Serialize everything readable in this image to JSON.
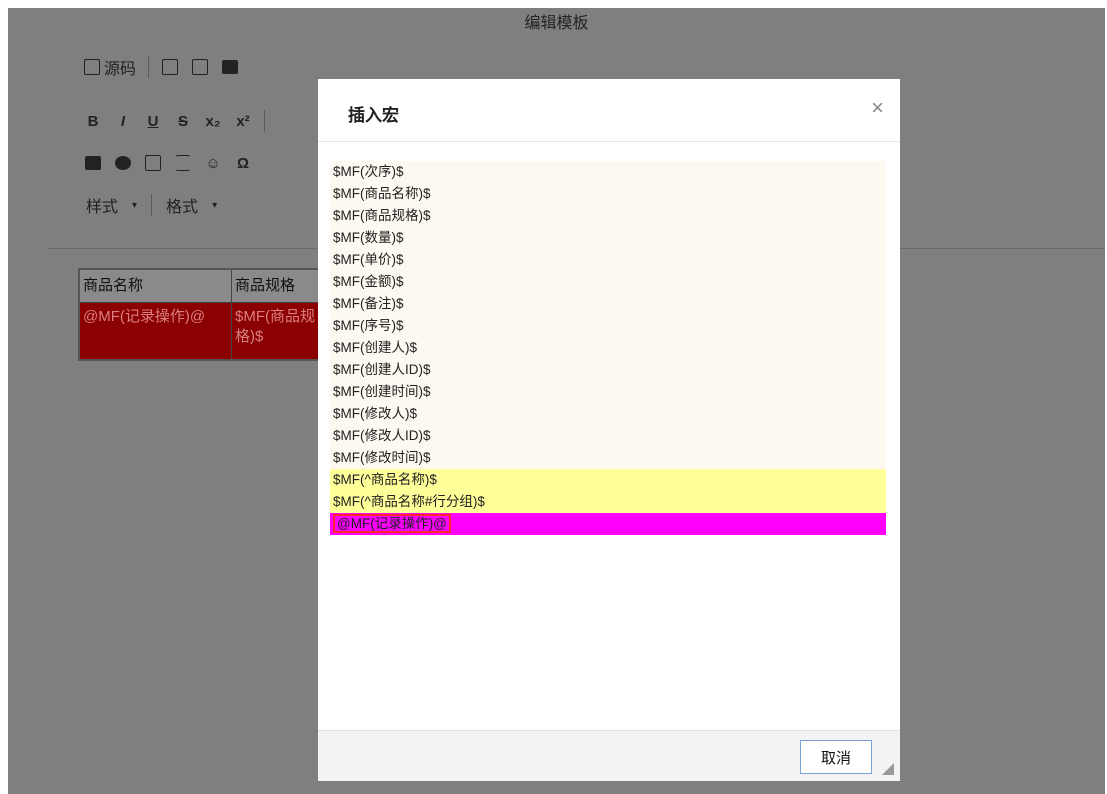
{
  "window": {
    "title": "编辑模板"
  },
  "toolbar": {
    "source_label": "源码",
    "style_label": "样式",
    "format_label": "格式",
    "bold": "B",
    "italic": "I",
    "underline": "U",
    "strike": "S",
    "subscript": "x₂",
    "superscript": "x²",
    "omega": "Ω",
    "smiley": "☺"
  },
  "table": {
    "headers": [
      "商品名称",
      "商品规格"
    ],
    "cells": [
      "@MF(记录操作)@",
      "$MF(商品规格)$"
    ]
  },
  "dialog": {
    "title": "插入宏",
    "close": "×",
    "cancel_label": "取消",
    "macros": [
      {
        "text": "$MF(次序)$",
        "highlight": "none"
      },
      {
        "text": "$MF(商品名称)$",
        "highlight": "none"
      },
      {
        "text": "$MF(商品规格)$",
        "highlight": "none"
      },
      {
        "text": "$MF(数量)$",
        "highlight": "none"
      },
      {
        "text": "$MF(单价)$",
        "highlight": "none"
      },
      {
        "text": "$MF(金额)$",
        "highlight": "none"
      },
      {
        "text": "$MF(备注)$",
        "highlight": "none"
      },
      {
        "text": "$MF(序号)$",
        "highlight": "none"
      },
      {
        "text": "$MF(创建人)$",
        "highlight": "none"
      },
      {
        "text": "$MF(创建人ID)$",
        "highlight": "none"
      },
      {
        "text": "$MF(创建时间)$",
        "highlight": "none"
      },
      {
        "text": "$MF(修改人)$",
        "highlight": "none"
      },
      {
        "text": "$MF(修改人ID)$",
        "highlight": "none"
      },
      {
        "text": "$MF(修改时间)$",
        "highlight": "none"
      },
      {
        "text": "$MF(^商品名称)$",
        "highlight": "yellow"
      },
      {
        "text": "$MF(^商品名称#行分组)$",
        "highlight": "yellow"
      },
      {
        "text": "@MF(记录操作)@",
        "highlight": "magenta"
      }
    ]
  },
  "colors": {
    "overlay": "#7f7f7f",
    "cell_highlight": "#8b0000",
    "macro_default_bg": "#fdf9f0",
    "macro_yellow": "#ffff99",
    "macro_magenta": "#ff00ff",
    "selection_border": "#ff2b2b"
  }
}
